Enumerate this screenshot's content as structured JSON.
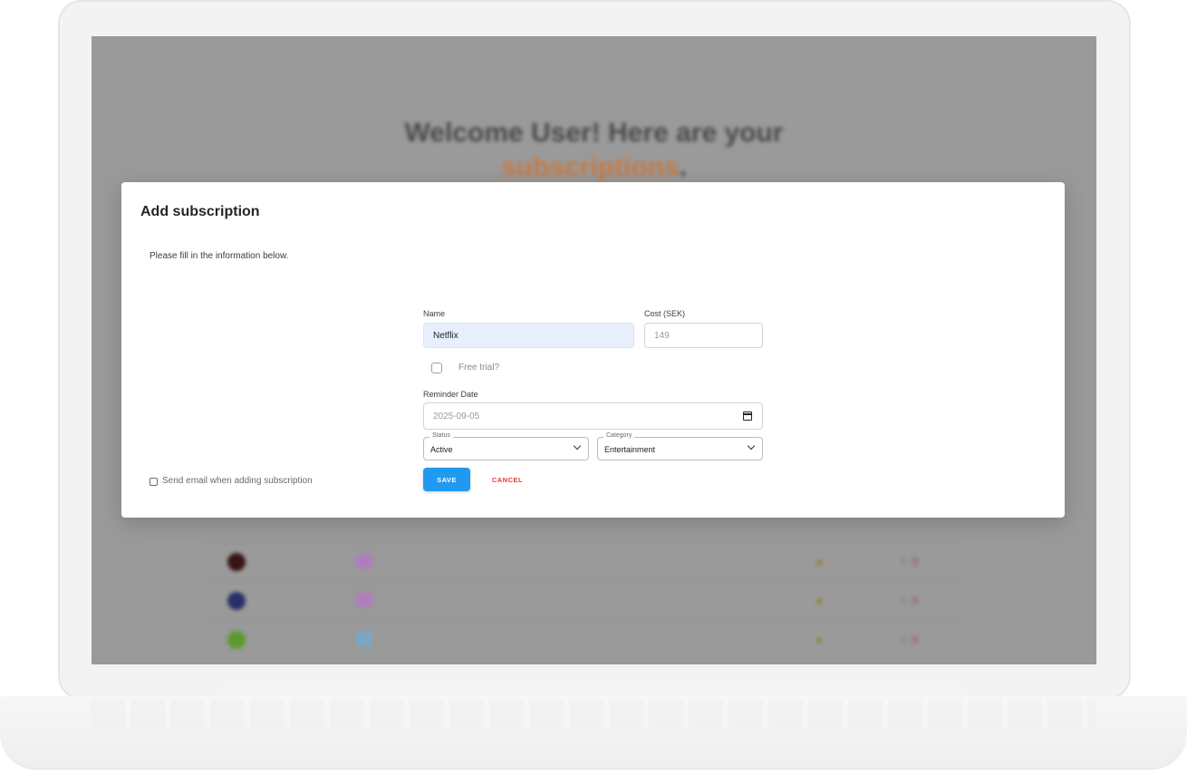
{
  "background": {
    "welcome_line1": "Welcome User! Here are your",
    "welcome_accent": "subscriptions",
    "welcome_period": "."
  },
  "modal": {
    "title": "Add subscription",
    "description": "Please fill in the information below.",
    "name_label": "Name",
    "name_value": "Netflix",
    "cost_label": "Cost (SEK)",
    "cost_placeholder": "149",
    "free_trial_label": "Free trial?",
    "free_trial_checked": false,
    "reminder_label": "Reminder Date",
    "reminder_value": "2025-09-05",
    "status_label": "Status",
    "status_value": "Active",
    "category_label": "Category",
    "category_value": "Entertainment",
    "save_label": "SAVE",
    "cancel_label": "CANCEL",
    "email_checkbox_label": "Send email when adding subscription",
    "email_checked": false
  },
  "colors": {
    "primary": "#1f9af0",
    "danger": "#e53935",
    "accent": "#c77a45",
    "overlay": "#9a9a9a"
  }
}
